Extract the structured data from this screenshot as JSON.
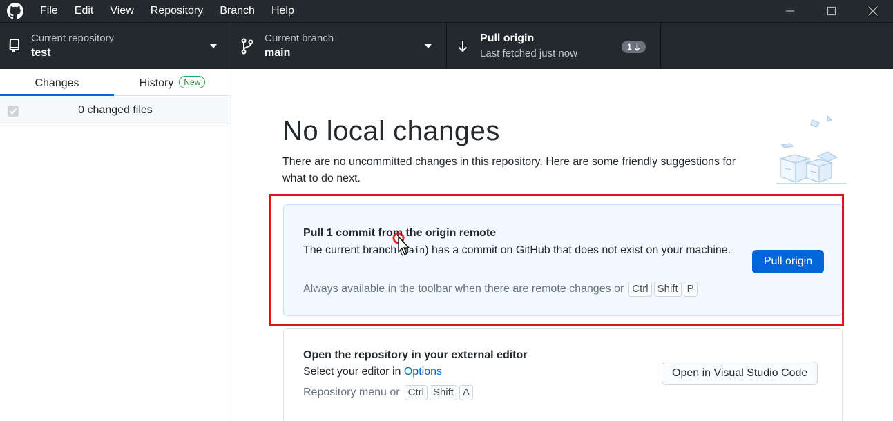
{
  "menu": {
    "items": [
      "File",
      "Edit",
      "View",
      "Repository",
      "Branch",
      "Help"
    ]
  },
  "window_controls": {
    "minimize_icon": "minimize-icon",
    "maximize_icon": "maximize-icon",
    "close_icon": "close-icon"
  },
  "toolbar": {
    "repo": {
      "label": "Current repository",
      "value": "test"
    },
    "branch": {
      "label": "Current branch",
      "value": "main"
    },
    "pull": {
      "label": "Pull origin",
      "sublabel": "Last fetched just now",
      "badge_count": "1"
    }
  },
  "sidebar": {
    "tabs": [
      {
        "label": "Changes",
        "active": true
      },
      {
        "label": "History",
        "badge": "New",
        "active": false
      }
    ],
    "changed_files": "0 changed files"
  },
  "main": {
    "heading": "No local changes",
    "subtext": "There are no uncommitted changes in this repository. Here are some friendly suggestions for what to do next.",
    "pull_card": {
      "title": "Pull 1 commit from the origin remote",
      "desc_before": "The current branch (",
      "desc_code": "main",
      "desc_after": ") has a commit on GitHub that does not exist on your machine.",
      "hint": "Always available in the toolbar when there are remote changes or",
      "keys": [
        "Ctrl",
        "Shift",
        "P"
      ],
      "button": "Pull origin"
    },
    "editor_card": {
      "title": "Open the repository in your external editor",
      "desc_before": "Select your editor in",
      "desc_link": "Options",
      "hint": "Repository menu or",
      "keys": [
        "Ctrl",
        "Shift",
        "A"
      ],
      "button": "Open in Visual Studio Code"
    }
  },
  "colors": {
    "titlebar": "#24292e",
    "accent": "#0366d6",
    "highlight_frame": "#e0121b",
    "new_badge": "#2ea44f"
  }
}
